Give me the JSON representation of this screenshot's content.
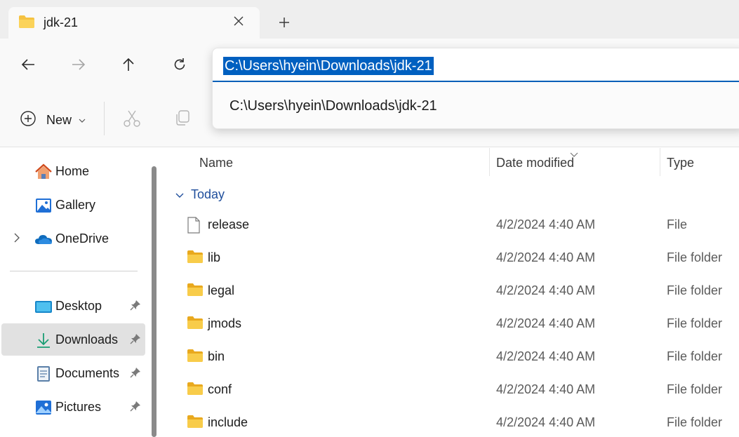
{
  "tab": {
    "title": "jdk-21"
  },
  "address": {
    "value": "C:\\Users\\hyein\\Downloads\\jdk-21",
    "suggestion": "C:\\Users\\hyein\\Downloads\\jdk-21"
  },
  "toolbar": {
    "new_label": "New"
  },
  "sidebar": {
    "items": [
      {
        "label": "Home",
        "icon": "home-icon"
      },
      {
        "label": "Gallery",
        "icon": "gallery-icon"
      },
      {
        "label": "OneDrive",
        "icon": "onedrive-icon"
      }
    ],
    "pinned": [
      {
        "label": "Desktop",
        "icon": "desktop-icon"
      },
      {
        "label": "Downloads",
        "icon": "downloads-icon",
        "selected": true
      },
      {
        "label": "Documents",
        "icon": "documents-icon"
      },
      {
        "label": "Pictures",
        "icon": "pictures-icon"
      }
    ]
  },
  "columns": {
    "name": "Name",
    "date": "Date modified",
    "type": "Type"
  },
  "group": {
    "label": "Today"
  },
  "files": [
    {
      "name": "release",
      "date": "4/2/2024 4:40 AM",
      "type": "File",
      "kind": "file"
    },
    {
      "name": "lib",
      "date": "4/2/2024 4:40 AM",
      "type": "File folder",
      "kind": "folder"
    },
    {
      "name": "legal",
      "date": "4/2/2024 4:40 AM",
      "type": "File folder",
      "kind": "folder"
    },
    {
      "name": "jmods",
      "date": "4/2/2024 4:40 AM",
      "type": "File folder",
      "kind": "folder"
    },
    {
      "name": "bin",
      "date": "4/2/2024 4:40 AM",
      "type": "File folder",
      "kind": "folder"
    },
    {
      "name": "conf",
      "date": "4/2/2024 4:40 AM",
      "type": "File folder",
      "kind": "folder"
    },
    {
      "name": "include",
      "date": "4/2/2024 4:40 AM",
      "type": "File folder",
      "kind": "folder"
    }
  ],
  "colors": {
    "accent": "#005fb8",
    "selection": "#0060c0",
    "folder": "#f5c241",
    "group": "#1f4e9c"
  }
}
